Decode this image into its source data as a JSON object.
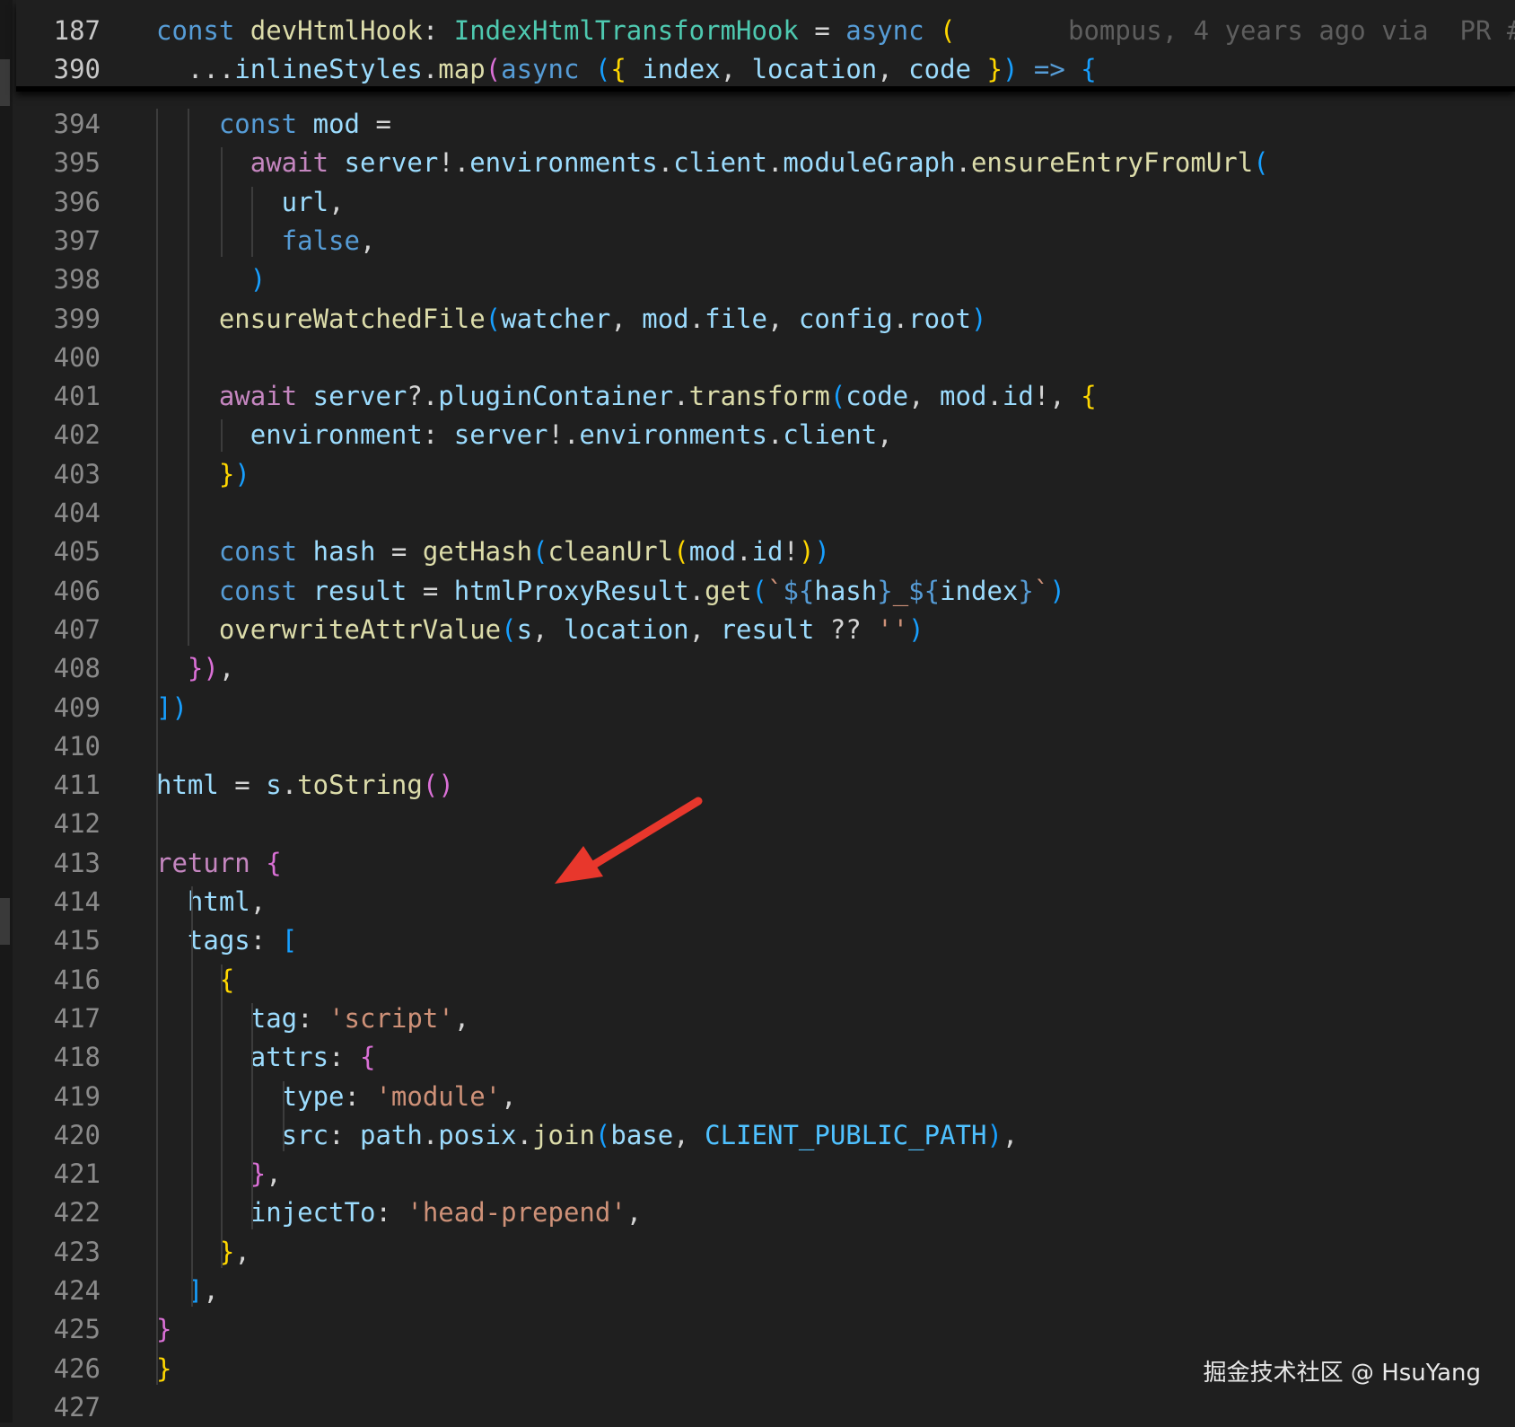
{
  "editor": {
    "sticky": [
      {
        "num": "187",
        "segments": [
          {
            "t": "const ",
            "c": "kw"
          },
          {
            "t": "devHtmlHook",
            "c": "fn"
          },
          {
            "t": ": ",
            "c": "p"
          },
          {
            "t": "IndexHtmlTransformHook",
            "c": "ty"
          },
          {
            "t": " = ",
            "c": "p"
          },
          {
            "t": "async",
            "c": "kw"
          },
          {
            "t": " ",
            "c": "p"
          },
          {
            "t": "(",
            "c": "b1"
          }
        ],
        "blame": "bompus, 4 years ago via  PR #"
      },
      {
        "num": "390",
        "segments": [
          {
            "t": "  ...",
            "c": "p"
          },
          {
            "t": "inlineStyles",
            "c": "var"
          },
          {
            "t": ".",
            "c": "p"
          },
          {
            "t": "map",
            "c": "fn"
          },
          {
            "t": "(",
            "c": "b2"
          },
          {
            "t": "async",
            "c": "kw"
          },
          {
            "t": " ",
            "c": "p"
          },
          {
            "t": "(",
            "c": "b3"
          },
          {
            "t": "{ ",
            "c": "b1"
          },
          {
            "t": "index",
            "c": "var"
          },
          {
            "t": ", ",
            "c": "p"
          },
          {
            "t": "location",
            "c": "var"
          },
          {
            "t": ", ",
            "c": "p"
          },
          {
            "t": "code",
            "c": "var"
          },
          {
            "t": " }",
            "c": "b1"
          },
          {
            "t": ")",
            "c": "b3"
          },
          {
            "t": " => ",
            "c": "kw"
          },
          {
            "t": "{",
            "c": "b3"
          }
        ]
      }
    ],
    "lines": [
      {
        "num": "394",
        "segments": [
          {
            "t": "    const ",
            "c": "kw"
          },
          {
            "t": "mod",
            "c": "var"
          },
          {
            "t": " =",
            "c": "p"
          }
        ]
      },
      {
        "num": "395",
        "segments": [
          {
            "t": "      await ",
            "c": "kw2"
          },
          {
            "t": "server",
            "c": "var"
          },
          {
            "t": "!.",
            "c": "p"
          },
          {
            "t": "environments",
            "c": "var"
          },
          {
            "t": ".",
            "c": "p"
          },
          {
            "t": "client",
            "c": "var"
          },
          {
            "t": ".",
            "c": "p"
          },
          {
            "t": "moduleGraph",
            "c": "var"
          },
          {
            "t": ".",
            "c": "p"
          },
          {
            "t": "ensureEntryFromUrl",
            "c": "fn"
          },
          {
            "t": "(",
            "c": "b3"
          }
        ]
      },
      {
        "num": "396",
        "segments": [
          {
            "t": "        url",
            "c": "var"
          },
          {
            "t": ",",
            "c": "p"
          }
        ]
      },
      {
        "num": "397",
        "segments": [
          {
            "t": "        false",
            "c": "kw"
          },
          {
            "t": ",",
            "c": "p"
          }
        ]
      },
      {
        "num": "398",
        "segments": [
          {
            "t": "      )",
            "c": "b3"
          }
        ]
      },
      {
        "num": "399",
        "segments": [
          {
            "t": "    ensureWatchedFile",
            "c": "fn"
          },
          {
            "t": "(",
            "c": "b3"
          },
          {
            "t": "watcher",
            "c": "var"
          },
          {
            "t": ", ",
            "c": "p"
          },
          {
            "t": "mod",
            "c": "var"
          },
          {
            "t": ".",
            "c": "p"
          },
          {
            "t": "file",
            "c": "var"
          },
          {
            "t": ", ",
            "c": "p"
          },
          {
            "t": "config",
            "c": "var"
          },
          {
            "t": ".",
            "c": "p"
          },
          {
            "t": "root",
            "c": "var"
          },
          {
            "t": ")",
            "c": "b3"
          }
        ]
      },
      {
        "num": "400",
        "segments": []
      },
      {
        "num": "401",
        "segments": [
          {
            "t": "    await ",
            "c": "kw2"
          },
          {
            "t": "server",
            "c": "var"
          },
          {
            "t": "?.",
            "c": "p"
          },
          {
            "t": "pluginContainer",
            "c": "var"
          },
          {
            "t": ".",
            "c": "p"
          },
          {
            "t": "transform",
            "c": "fn"
          },
          {
            "t": "(",
            "c": "b3"
          },
          {
            "t": "code",
            "c": "var"
          },
          {
            "t": ", ",
            "c": "p"
          },
          {
            "t": "mod",
            "c": "var"
          },
          {
            "t": ".",
            "c": "p"
          },
          {
            "t": "id",
            "c": "var"
          },
          {
            "t": "!, ",
            "c": "p"
          },
          {
            "t": "{",
            "c": "b1"
          }
        ]
      },
      {
        "num": "402",
        "segments": [
          {
            "t": "      environment",
            "c": "var"
          },
          {
            "t": ": ",
            "c": "p"
          },
          {
            "t": "server",
            "c": "var"
          },
          {
            "t": "!.",
            "c": "p"
          },
          {
            "t": "environments",
            "c": "var"
          },
          {
            "t": ".",
            "c": "p"
          },
          {
            "t": "client",
            "c": "var"
          },
          {
            "t": ",",
            "c": "p"
          }
        ]
      },
      {
        "num": "403",
        "segments": [
          {
            "t": "    }",
            "c": "b1"
          },
          {
            "t": ")",
            "c": "b3"
          }
        ]
      },
      {
        "num": "404",
        "segments": []
      },
      {
        "num": "405",
        "segments": [
          {
            "t": "    const ",
            "c": "kw"
          },
          {
            "t": "hash",
            "c": "var"
          },
          {
            "t": " = ",
            "c": "p"
          },
          {
            "t": "getHash",
            "c": "fn"
          },
          {
            "t": "(",
            "c": "b3"
          },
          {
            "t": "cleanUrl",
            "c": "fn"
          },
          {
            "t": "(",
            "c": "b1"
          },
          {
            "t": "mod",
            "c": "var"
          },
          {
            "t": ".",
            "c": "p"
          },
          {
            "t": "id",
            "c": "var"
          },
          {
            "t": "!",
            "c": "p"
          },
          {
            "t": ")",
            "c": "b1"
          },
          {
            "t": ")",
            "c": "b3"
          }
        ]
      },
      {
        "num": "406",
        "segments": [
          {
            "t": "    const ",
            "c": "kw"
          },
          {
            "t": "result",
            "c": "var"
          },
          {
            "t": " = ",
            "c": "p"
          },
          {
            "t": "htmlProxyResult",
            "c": "var"
          },
          {
            "t": ".",
            "c": "p"
          },
          {
            "t": "get",
            "c": "fn"
          },
          {
            "t": "(",
            "c": "b3"
          },
          {
            "t": "`",
            "c": "str"
          },
          {
            "t": "${",
            "c": "kw"
          },
          {
            "t": "hash",
            "c": "var"
          },
          {
            "t": "}",
            "c": "kw"
          },
          {
            "t": "_",
            "c": "str"
          },
          {
            "t": "${",
            "c": "kw"
          },
          {
            "t": "index",
            "c": "var"
          },
          {
            "t": "}",
            "c": "kw"
          },
          {
            "t": "`",
            "c": "str"
          },
          {
            "t": ")",
            "c": "b3"
          }
        ]
      },
      {
        "num": "407",
        "segments": [
          {
            "t": "    overwriteAttrValue",
            "c": "fn"
          },
          {
            "t": "(",
            "c": "b3"
          },
          {
            "t": "s",
            "c": "var"
          },
          {
            "t": ", ",
            "c": "p"
          },
          {
            "t": "location",
            "c": "var"
          },
          {
            "t": ", ",
            "c": "p"
          },
          {
            "t": "result",
            "c": "var"
          },
          {
            "t": " ?? ",
            "c": "p"
          },
          {
            "t": "''",
            "c": "str"
          },
          {
            "t": ")",
            "c": "b3"
          }
        ]
      },
      {
        "num": "408",
        "segments": [
          {
            "t": "  })",
            "c": "b2"
          },
          {
            "t": ",",
            "c": "p"
          }
        ]
      },
      {
        "num": "409",
        "segments": [
          {
            "t": "])",
            "c": "b3"
          }
        ]
      },
      {
        "num": "410",
        "segments": []
      },
      {
        "num": "411",
        "segments": [
          {
            "t": "html",
            "c": "var"
          },
          {
            "t": " = ",
            "c": "p"
          },
          {
            "t": "s",
            "c": "var"
          },
          {
            "t": ".",
            "c": "p"
          },
          {
            "t": "toString",
            "c": "fn"
          },
          {
            "t": "()",
            "c": "b2"
          }
        ]
      },
      {
        "num": "412",
        "segments": []
      },
      {
        "num": "413",
        "segments": [
          {
            "t": "return ",
            "c": "kw2"
          },
          {
            "t": "{",
            "c": "b2"
          }
        ]
      },
      {
        "num": "414",
        "segments": [
          {
            "t": "  html",
            "c": "var"
          },
          {
            "t": ",",
            "c": "p"
          }
        ]
      },
      {
        "num": "415",
        "segments": [
          {
            "t": "  tags",
            "c": "var"
          },
          {
            "t": ": ",
            "c": "p"
          },
          {
            "t": "[",
            "c": "b3"
          }
        ]
      },
      {
        "num": "416",
        "segments": [
          {
            "t": "    {",
            "c": "b1"
          }
        ]
      },
      {
        "num": "417",
        "segments": [
          {
            "t": "      tag",
            "c": "var"
          },
          {
            "t": ": ",
            "c": "p"
          },
          {
            "t": "'script'",
            "c": "str"
          },
          {
            "t": ",",
            "c": "p"
          }
        ]
      },
      {
        "num": "418",
        "segments": [
          {
            "t": "      attrs",
            "c": "var"
          },
          {
            "t": ": ",
            "c": "p"
          },
          {
            "t": "{",
            "c": "b2"
          }
        ]
      },
      {
        "num": "419",
        "segments": [
          {
            "t": "        type",
            "c": "var"
          },
          {
            "t": ": ",
            "c": "p"
          },
          {
            "t": "'module'",
            "c": "str"
          },
          {
            "t": ",",
            "c": "p"
          }
        ]
      },
      {
        "num": "420",
        "segments": [
          {
            "t": "        src",
            "c": "var"
          },
          {
            "t": ": ",
            "c": "p"
          },
          {
            "t": "path",
            "c": "var"
          },
          {
            "t": ".",
            "c": "p"
          },
          {
            "t": "posix",
            "c": "var"
          },
          {
            "t": ".",
            "c": "p"
          },
          {
            "t": "join",
            "c": "fn"
          },
          {
            "t": "(",
            "c": "b3"
          },
          {
            "t": "base",
            "c": "var"
          },
          {
            "t": ", ",
            "c": "p"
          },
          {
            "t": "CLIENT_PUBLIC_PATH",
            "c": "con"
          },
          {
            "t": ")",
            "c": "b3"
          },
          {
            "t": ",",
            "c": "p"
          }
        ]
      },
      {
        "num": "421",
        "segments": [
          {
            "t": "      }",
            "c": "b2"
          },
          {
            "t": ",",
            "c": "p"
          }
        ]
      },
      {
        "num": "422",
        "segments": [
          {
            "t": "      injectTo",
            "c": "var"
          },
          {
            "t": ": ",
            "c": "p"
          },
          {
            "t": "'head-prepend'",
            "c": "str"
          },
          {
            "t": ",",
            "c": "p"
          }
        ]
      },
      {
        "num": "423",
        "segments": [
          {
            "t": "    }",
            "c": "b1"
          },
          {
            "t": ",",
            "c": "p"
          }
        ]
      },
      {
        "num": "424",
        "segments": [
          {
            "t": "  ]",
            "c": "b3"
          },
          {
            "t": ",",
            "c": "p"
          }
        ]
      },
      {
        "num": "425",
        "segments": [
          {
            "t": "}",
            "c": "b2"
          }
        ]
      },
      {
        "num": "426",
        "segments": [
          {
            "t": "}",
            "c": "b1"
          }
        ]
      },
      {
        "num": "427",
        "segments": []
      }
    ]
  },
  "annotation": {
    "arrow_color": "#e8372c",
    "arrow_icon": "red-arrow-icon"
  },
  "watermark": "掘金技术社区 @ HsuYang"
}
